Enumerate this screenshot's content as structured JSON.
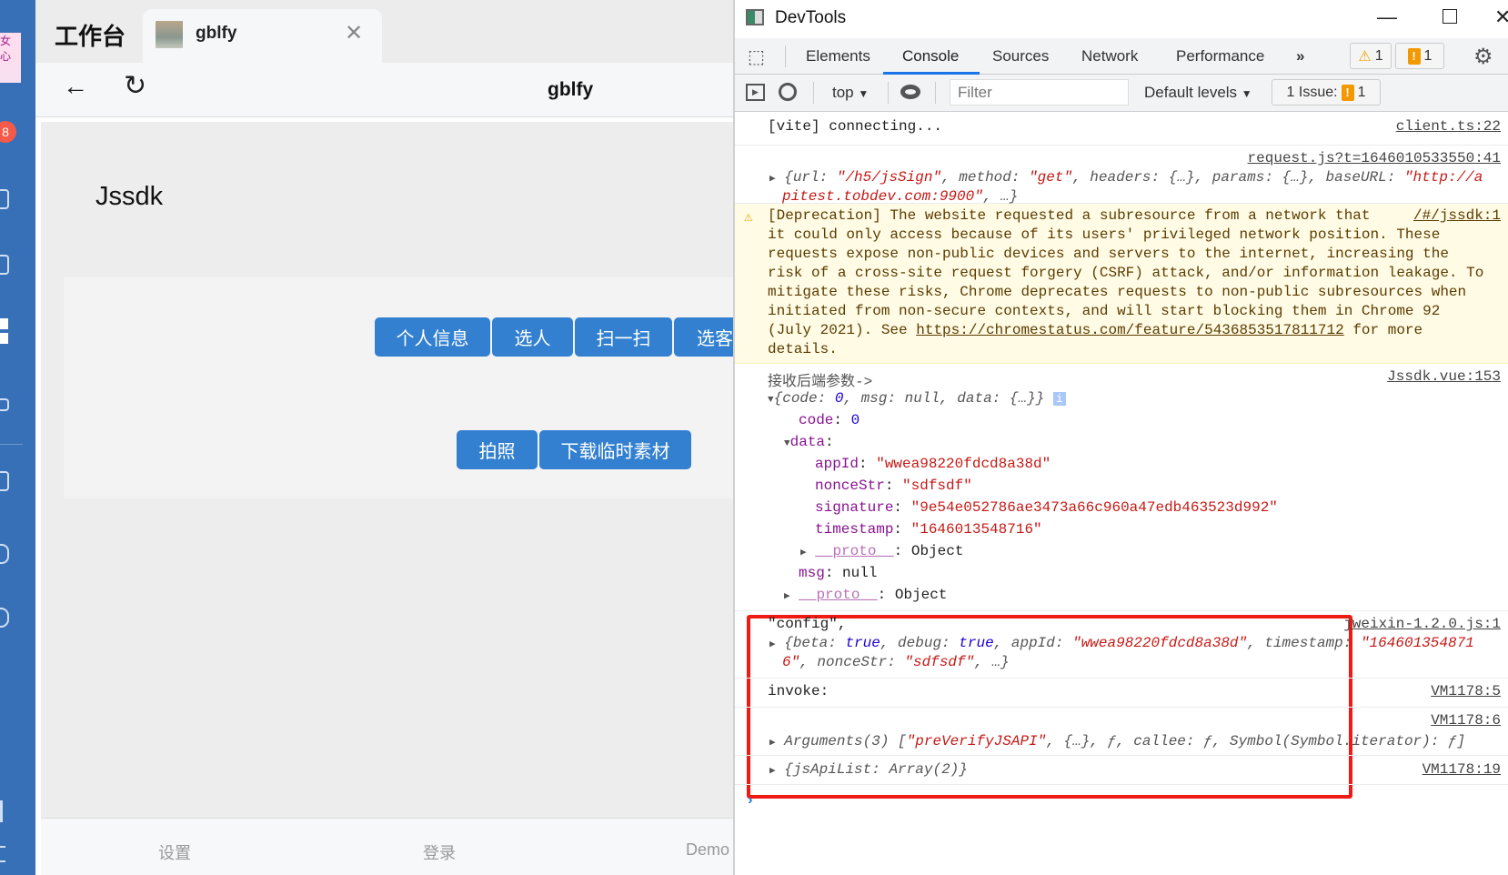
{
  "app": {
    "title": "工作台",
    "badge": "8",
    "tab": {
      "label": "gblfy"
    },
    "nav": {
      "title": "gblfy"
    },
    "page": {
      "heading": "Jssdk",
      "buttons_row1": [
        "个人信息",
        "选人",
        "扫一扫",
        "选客"
      ],
      "buttons_row2": [
        "拍照",
        "下载临时素材"
      ]
    },
    "footer": [
      "设置",
      "登录",
      "Demo"
    ],
    "accent": "#3380d0",
    "sidebar_color": "#3870b8"
  },
  "devtools": {
    "title": "DevTools",
    "tabs": [
      "Elements",
      "Console",
      "Sources",
      "Network",
      "Performance"
    ],
    "active_tab": "Console",
    "warnings": "1",
    "errors": "1",
    "context": "top",
    "filter_placeholder": "Filter",
    "levels": "Default levels",
    "issues_label": "1 Issue:",
    "issues_count": "1",
    "console": {
      "vite": {
        "text": "[vite] connecting...",
        "src": "client.ts:22"
      },
      "request": {
        "src": "request.js?t=1646010533550:41",
        "line1": {
          "url": "\"/h5/jsSign\"",
          "method": "\"get\"",
          "base": "\"http://a"
        },
        "line2": "pitest.tobdev.com:9900\""
      },
      "deprecation": {
        "src": "/#/jssdk:1",
        "lines": [
          "[Deprecation] The website requested a subresource from a network that",
          "it could only access because of its users' privileged network position. These",
          "requests expose non-public devices and servers to the internet, increasing the",
          "risk of a cross-site request forgery (CSRF) attack, and/or information leakage. To",
          "mitigate these risks, Chrome deprecates requests to non-public subresources when",
          "initiated from non-secure contexts, and will start blocking them in Chrome 92"
        ],
        "line7_pre": "(July 2021). See ",
        "link": "https://chromestatus.com/feature/5436853517811712",
        "line7_post": " for more",
        "line8": "details."
      },
      "group": {
        "label": "接收后端参数->",
        "src": "Jssdk.vue:153",
        "code": "0",
        "appId": "\"wwea98220fdcd8a38d\"",
        "nonceStr": "\"sdfsdf\"",
        "signature": "\"9e54e052786ae3473a66c960a47edb463523d992\"",
        "timestamp": "\"1646013548716\"",
        "msg": "null",
        "proto": "Object"
      },
      "config": {
        "label": "\"config\",",
        "src": "jweixin-1.2.0.js:1",
        "appId": "\"wwea98220fdcd8a38d\"",
        "ts1": "\"164601354871",
        "ts2": "6\"",
        "nonceStr": "\"sdfsdf\""
      },
      "invoke": {
        "label": "invoke:",
        "src": "VM1178:5"
      },
      "args": {
        "src": "VM1178:6",
        "api": "\"preVerifyJSAPI\""
      },
      "jsapi": {
        "text": "{jsApiList: Array(2)}",
        "src": "VM1178:19"
      }
    }
  }
}
